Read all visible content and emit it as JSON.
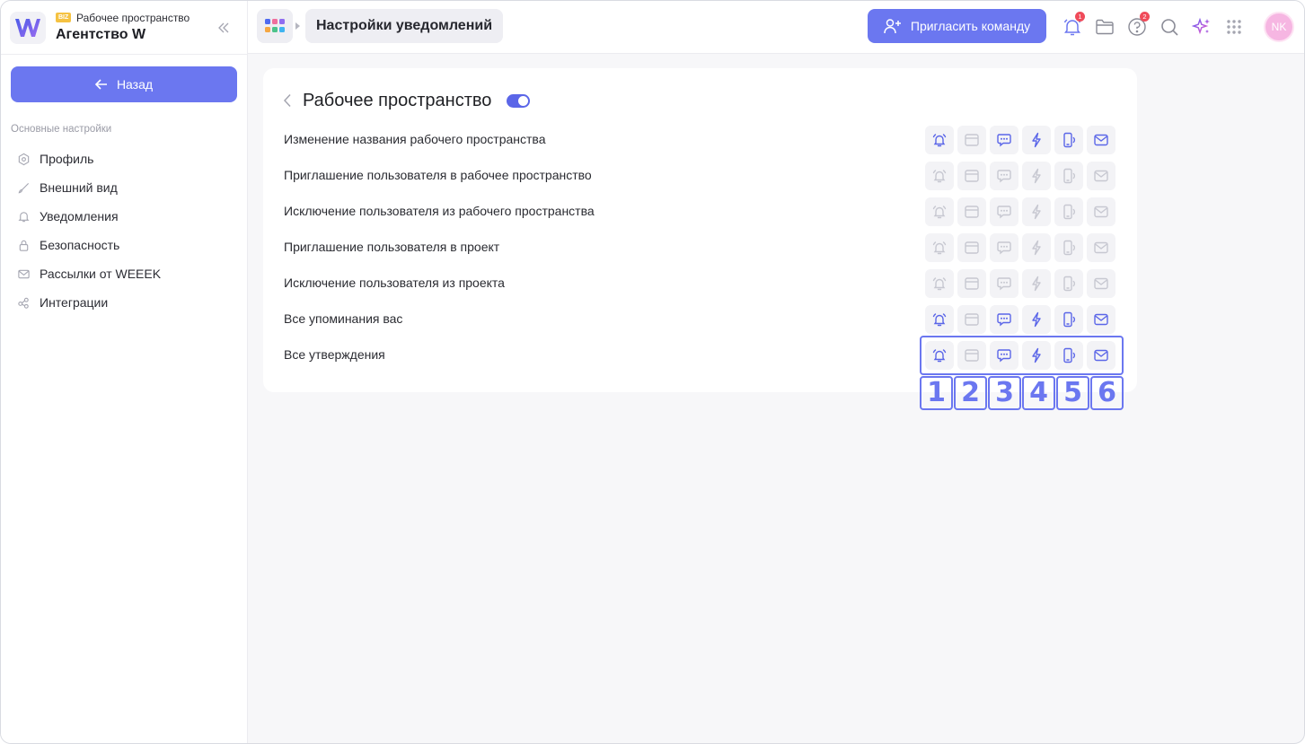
{
  "workspace": {
    "badge": "BIZ",
    "type_label": "Рабочее пространство",
    "name": "Агентство W",
    "logo_letter": "W"
  },
  "sidebar": {
    "back_label": "Назад",
    "section_title": "Основные настройки",
    "items": [
      {
        "label": "Профиль",
        "icon": "hexagon-icon"
      },
      {
        "label": "Внешний вид",
        "icon": "brush-icon"
      },
      {
        "label": "Уведомления",
        "icon": "bell-icon"
      },
      {
        "label": "Безопасность",
        "icon": "lock-icon"
      },
      {
        "label": "Рассылки от WEEEK",
        "icon": "mail-icon"
      },
      {
        "label": "Интеграции",
        "icon": "integrations-icon"
      }
    ]
  },
  "topbar": {
    "breadcrumb": "Настройки уведомлений",
    "invite_label": "Пригласить команду",
    "notifications_badge": "1",
    "help_badge": "2",
    "avatar_initials": "NK"
  },
  "card": {
    "title": "Рабочее пространство",
    "toggle_on": true,
    "channels": [
      "bell-icon",
      "browser-icon",
      "chat-icon",
      "lightning-icon",
      "phone-icon",
      "mail-icon"
    ],
    "rows": [
      {
        "label": "Изменение названия рабочего пространства",
        "states": [
          true,
          false,
          true,
          true,
          true,
          true
        ]
      },
      {
        "label": "Приглашение пользователя в рабочее пространство",
        "states": [
          false,
          false,
          false,
          false,
          false,
          false
        ]
      },
      {
        "label": "Исключение пользователя из рабочего пространства",
        "states": [
          false,
          false,
          false,
          false,
          false,
          false
        ]
      },
      {
        "label": "Приглашение пользователя в проект",
        "states": [
          false,
          false,
          false,
          false,
          false,
          false
        ]
      },
      {
        "label": "Исключение пользователя из проекта",
        "states": [
          false,
          false,
          false,
          false,
          false,
          false
        ]
      },
      {
        "label": "Все упоминания вас",
        "states": [
          true,
          false,
          true,
          true,
          true,
          true
        ]
      },
      {
        "label": "Все утверждения",
        "states": [
          true,
          false,
          true,
          true,
          true,
          true
        ]
      }
    ]
  },
  "annotation": {
    "numbers": [
      "1",
      "2",
      "3",
      "4",
      "5",
      "6"
    ]
  },
  "colors": {
    "accent": "#6b77f0",
    "toggle": "#5b66e8",
    "icon_off": "#c7c8d1",
    "badge": "#f04b5a",
    "avatar": "#f6b6e2"
  }
}
